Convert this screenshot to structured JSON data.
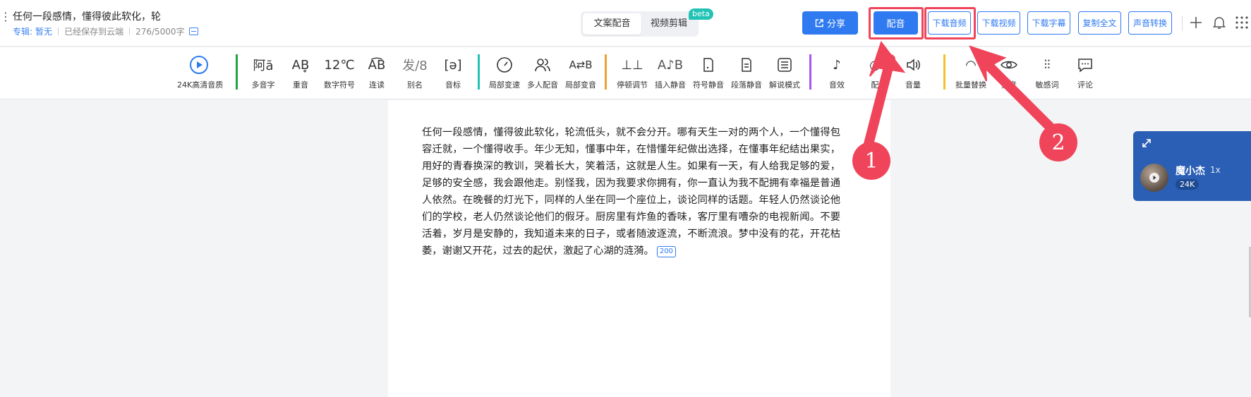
{
  "header": {
    "doc_title": "任何一段感情，懂得彼此软化，轮",
    "album_label": "专辑:",
    "album_value": "暂无",
    "save_status": "已经保存到云端",
    "word_count": "276/5000字",
    "mode_tabs": [
      {
        "label": "文案配音",
        "active": true
      },
      {
        "label": "视频剪辑",
        "active": false
      }
    ],
    "beta_badge": "beta",
    "share_label": "分享",
    "dub_label": "配音",
    "outline_buttons": [
      "下载音频",
      "下载视频",
      "下载字幕",
      "复制全文",
      "声音转换"
    ]
  },
  "toolbar": {
    "items": [
      {
        "label": "24K高清音质",
        "icon": "play-circle-icon"
      },
      {
        "label": "多音字",
        "icon": "polyphone-icon"
      },
      {
        "label": "重音",
        "icon": "stress-icon"
      },
      {
        "label": "数字符号",
        "icon": "number-symbol-icon"
      },
      {
        "label": "连读",
        "icon": "liaison-icon"
      },
      {
        "label": "别名",
        "icon": "alias-icon"
      },
      {
        "label": "音标",
        "icon": "phonetic-icon"
      },
      {
        "label": "局部变速",
        "icon": "speedometer-icon"
      },
      {
        "label": "多人配音",
        "icon": "users-icon"
      },
      {
        "label": "局部变音",
        "icon": "voice-swap-icon"
      },
      {
        "label": "停顿调节",
        "icon": "pause-adjust-icon"
      },
      {
        "label": "插入静音",
        "icon": "insert-silence-icon"
      },
      {
        "label": "符号静音",
        "icon": "symbol-mute-icon"
      },
      {
        "label": "段落静音",
        "icon": "paragraph-mute-icon"
      },
      {
        "label": "解说模式",
        "icon": "narration-mode-icon"
      },
      {
        "label": "音效",
        "icon": "sound-effect-icon"
      },
      {
        "label": "配",
        "icon": "music-icon"
      },
      {
        "label": "音量",
        "icon": "volume-icon"
      },
      {
        "label": "批量替换",
        "icon": "batch-replace-icon"
      },
      {
        "label": "拼音",
        "icon": "eye-icon"
      },
      {
        "label": "敏感词",
        "icon": "sensitive-word-icon"
      },
      {
        "label": "评论",
        "icon": "comment-icon"
      }
    ],
    "divider_colors": [
      "#22a34a",
      "#22c3b5",
      "#f0a030",
      "#a855f7",
      "#f0c030"
    ]
  },
  "document": {
    "text": "任何一段感情，懂得彼此软化，轮流低头，就不会分开。哪有天生一对的两个人，一个懂得包容迁就，一个懂得收手。年少无知，懂事中年，在惜懂年纪做出选择，在懂事年纪结出果实，用好的青春换深的教训，哭着长大，笑着活，这就是人生。如果有一天，有人给我足够的爱，足够的安全感，我会跟他走。别怪我，因为我要求你拥有，你一直认为我不配拥有幸福是普通人依然。在晚餐的灯光下，同样的人坐在同一个座位上，谈论同样的话题。年轻人仍然谈论他们的学校，老人仍然谈论他们的假牙。厨房里有炸鱼的香味，客厅里有嘈杂的电视新闻。不要活着，岁月是安静的，我知道未来的日子，或者随波逐流，不断流浪。梦中没有的花，开花枯萎，谢谢又开花，过去的起伏，激起了心湖的涟漪。",
    "char_badge": "200"
  },
  "voice_panel": {
    "name": "魔小杰",
    "speed": "1x",
    "quality_tag": "24K"
  },
  "annotations": {
    "callout_1": "1",
    "callout_2": "2"
  },
  "colors": {
    "primary": "#2f7af0",
    "highlight": "#f0445a",
    "voice_panel": "#2b5fb5"
  }
}
